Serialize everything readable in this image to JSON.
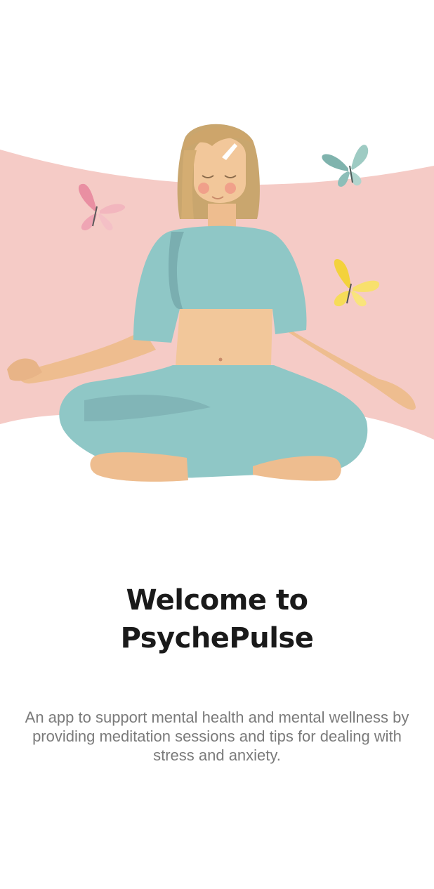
{
  "onboarding": {
    "title_line1": "Welcome to",
    "title_line2": "PsychePulse",
    "description": "An app to support mental health and mental wellness by providing meditation sessions and tips for dealing with stress and anxiety."
  },
  "colors": {
    "background": "#ffffff",
    "accent_pink": "#f5cbc6",
    "outfit_teal": "#8fc7c6",
    "title": "#1a1a1a",
    "description": "#7a7a7a"
  },
  "icons": [
    "meditation-illustration",
    "butterfly-icon"
  ]
}
